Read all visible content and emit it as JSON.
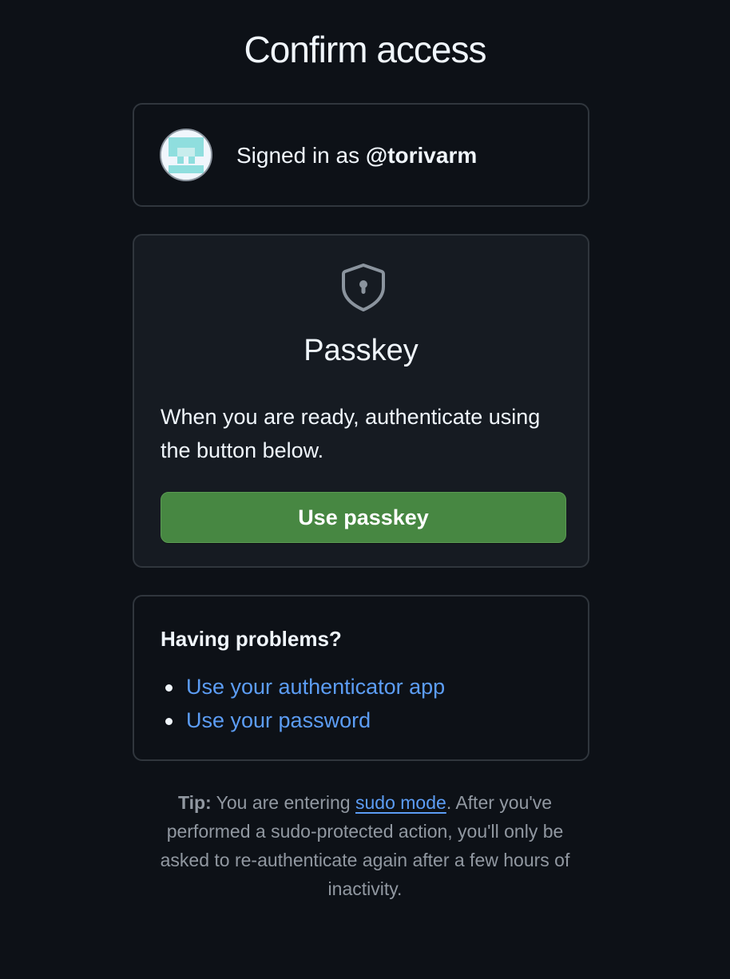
{
  "page": {
    "title": "Confirm access"
  },
  "account": {
    "signed_in_prefix": "Signed in as ",
    "username": "@torivarm"
  },
  "passkey": {
    "icon": "shield-lock-icon",
    "title": "Passkey",
    "description": "When you are ready, authenticate using the button below.",
    "button_label": "Use passkey"
  },
  "problems": {
    "title": "Having problems?",
    "links": [
      "Use your authenticator app",
      "Use your password"
    ]
  },
  "tip": {
    "label": "Tip:",
    "before_link": " You are entering ",
    "link": "sudo mode",
    "after_link": ". After you've performed a sudo-protected action, you'll only be asked to re-authenticate again after a few hours of inactivity."
  },
  "colors": {
    "background": "#0d1117",
    "button": "#478742",
    "link": "#5c9df5"
  }
}
